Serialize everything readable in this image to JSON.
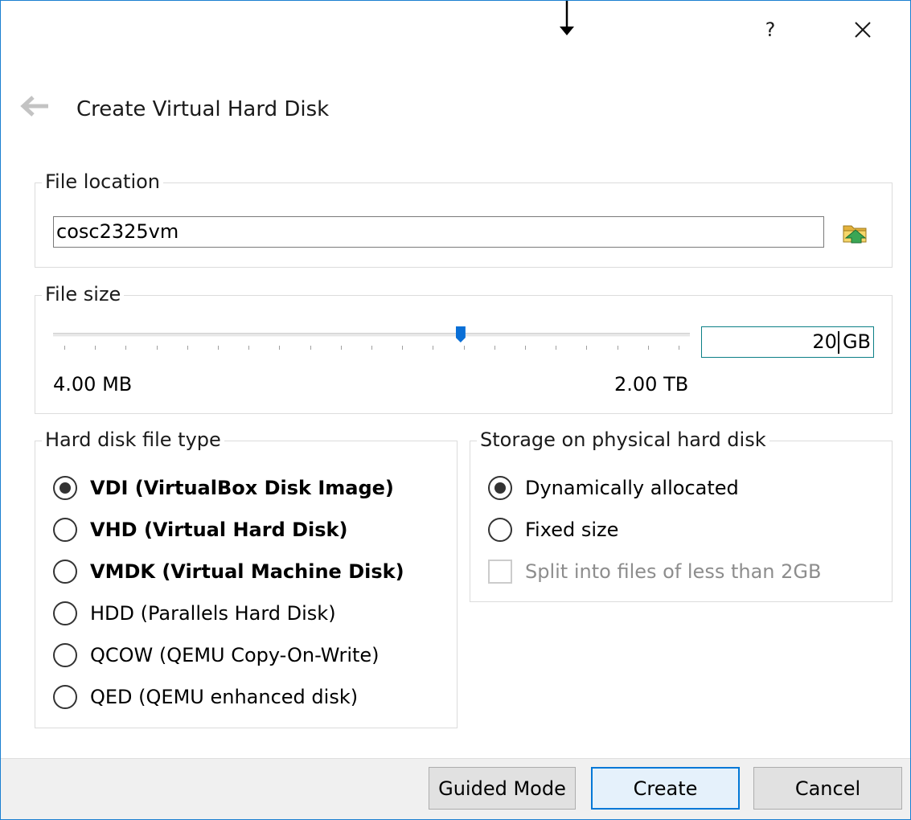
{
  "titlebar": {
    "help_label": "?",
    "close_icon": "close-icon"
  },
  "header": {
    "back_icon": "back-arrow-icon",
    "title": "Create Virtual Hard Disk"
  },
  "file_location": {
    "group_label": "File location",
    "value": "cosc2325vm",
    "browse_icon": "folder-browse-icon"
  },
  "file_size": {
    "group_label": "File size",
    "slider_fraction": 0.64,
    "value": "20",
    "unit": "GB",
    "range_min": "4.00 MB",
    "range_max": "2.00 TB"
  },
  "disk_type": {
    "group_label": "Hard disk file type",
    "selected": 0,
    "options": [
      {
        "label": "VDI (VirtualBox Disk Image)",
        "bold": true
      },
      {
        "label": "VHD (Virtual Hard Disk)",
        "bold": true
      },
      {
        "label": "VMDK (Virtual Machine Disk)",
        "bold": true
      },
      {
        "label": "HDD (Parallels Hard Disk)",
        "bold": false
      },
      {
        "label": "QCOW (QEMU Copy-On-Write)",
        "bold": false
      },
      {
        "label": "QED (QEMU enhanced disk)",
        "bold": false
      }
    ]
  },
  "storage": {
    "group_label": "Storage on physical hard disk",
    "selected": 0,
    "options": [
      {
        "label": "Dynamically allocated"
      },
      {
        "label": "Fixed size"
      }
    ],
    "split_label": "Split into files of less than 2GB",
    "split_checked": false,
    "split_enabled": false
  },
  "footer": {
    "guided_label": "Guided Mode",
    "create_label": "Create",
    "cancel_label": "Cancel"
  },
  "colors": {
    "accent": "#0078d7",
    "slider_thumb": "#0a6fd6",
    "window_border": "#1b7fd1",
    "footer_bg": "#f0f0f0"
  }
}
